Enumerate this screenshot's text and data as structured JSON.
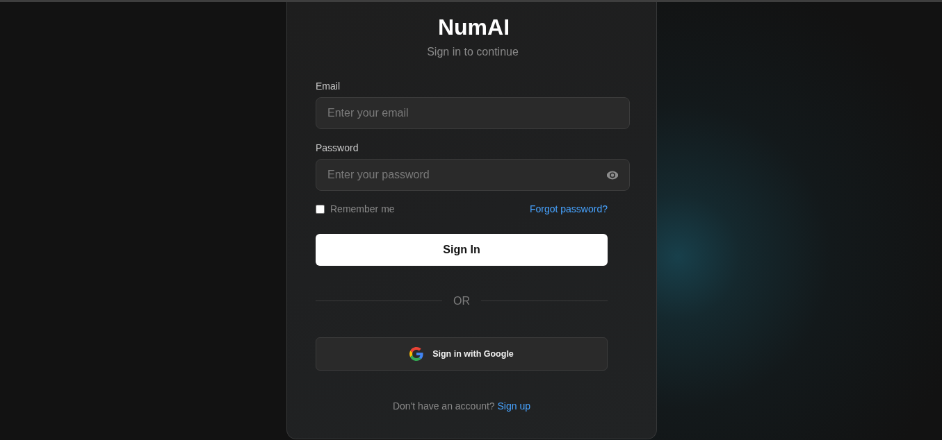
{
  "header": {
    "title": "NumAI",
    "subtitle": "Sign in to continue"
  },
  "form": {
    "fields": [
      {
        "kind": "email",
        "label": "Email",
        "placeholder": "Enter your email"
      },
      {
        "kind": "password",
        "label": "Password",
        "placeholder": "Enter your password"
      }
    ],
    "remember": {
      "label": "Remember me",
      "checked": false
    },
    "forgot_link": "Forgot password?",
    "submit": "Sign In",
    "divider": "OR",
    "google_button": "Sign in with Google"
  },
  "footer": {
    "text": "Don't have an account?",
    "link": "Sign up"
  }
}
